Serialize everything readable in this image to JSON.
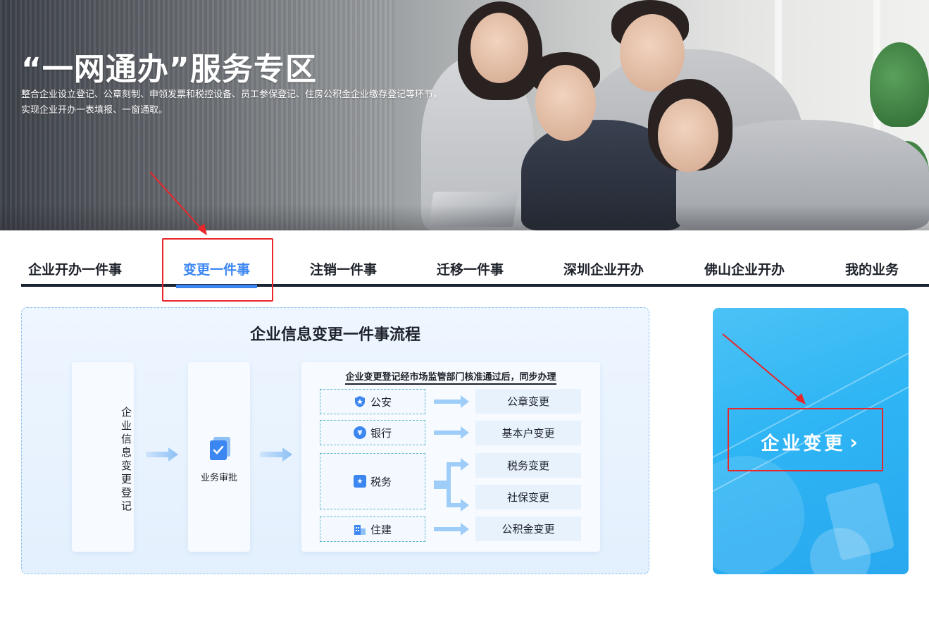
{
  "banner": {
    "title": "“一网通办”服务专区",
    "desc_line1": "整合企业设立登记、公章刻制、申领发票和税控设备、员工参保登记、住房公积金企业缴存登记等环节，",
    "desc_line2": "实现企业开办一表填报、一窗通取。"
  },
  "tabs": [
    {
      "label": "企业开办一件事",
      "active": false
    },
    {
      "label": "变更一件事",
      "active": true
    },
    {
      "label": "注销一件事",
      "active": false
    },
    {
      "label": "迁移一件事",
      "active": false
    },
    {
      "label": "深圳企业开办",
      "active": false
    },
    {
      "label": "佛山企业开办",
      "active": false
    },
    {
      "label": "我的业务",
      "active": false
    }
  ],
  "flow": {
    "title": "企业信息变更一件事流程",
    "step1": "企业信息变更登记",
    "step2": "业务审批",
    "sync_title": "企业变更登记经市场监管部门核准通过后，同步办理",
    "departments": [
      {
        "label": "公安",
        "icon": "police-badge-icon",
        "color": "#3b86f1"
      },
      {
        "label": "银行",
        "icon": "yuan-coin-icon",
        "color": "#3b86f1"
      },
      {
        "label": "税务",
        "icon": "tax-icon",
        "color": "#3b86f1"
      },
      {
        "label": "住建",
        "icon": "building-icon",
        "color": "#3b86f1"
      }
    ],
    "results": [
      "公章变更",
      "基本户变更",
      "税务变更",
      "社保变更",
      "公积金变更"
    ]
  },
  "cta": {
    "label": "企业变更",
    "chevron": "›"
  },
  "colors": {
    "accent": "#3b86f1",
    "annotation": "#e8262b",
    "tab_underline": "#1b2434",
    "cta_bg": "#2eb5f4"
  }
}
